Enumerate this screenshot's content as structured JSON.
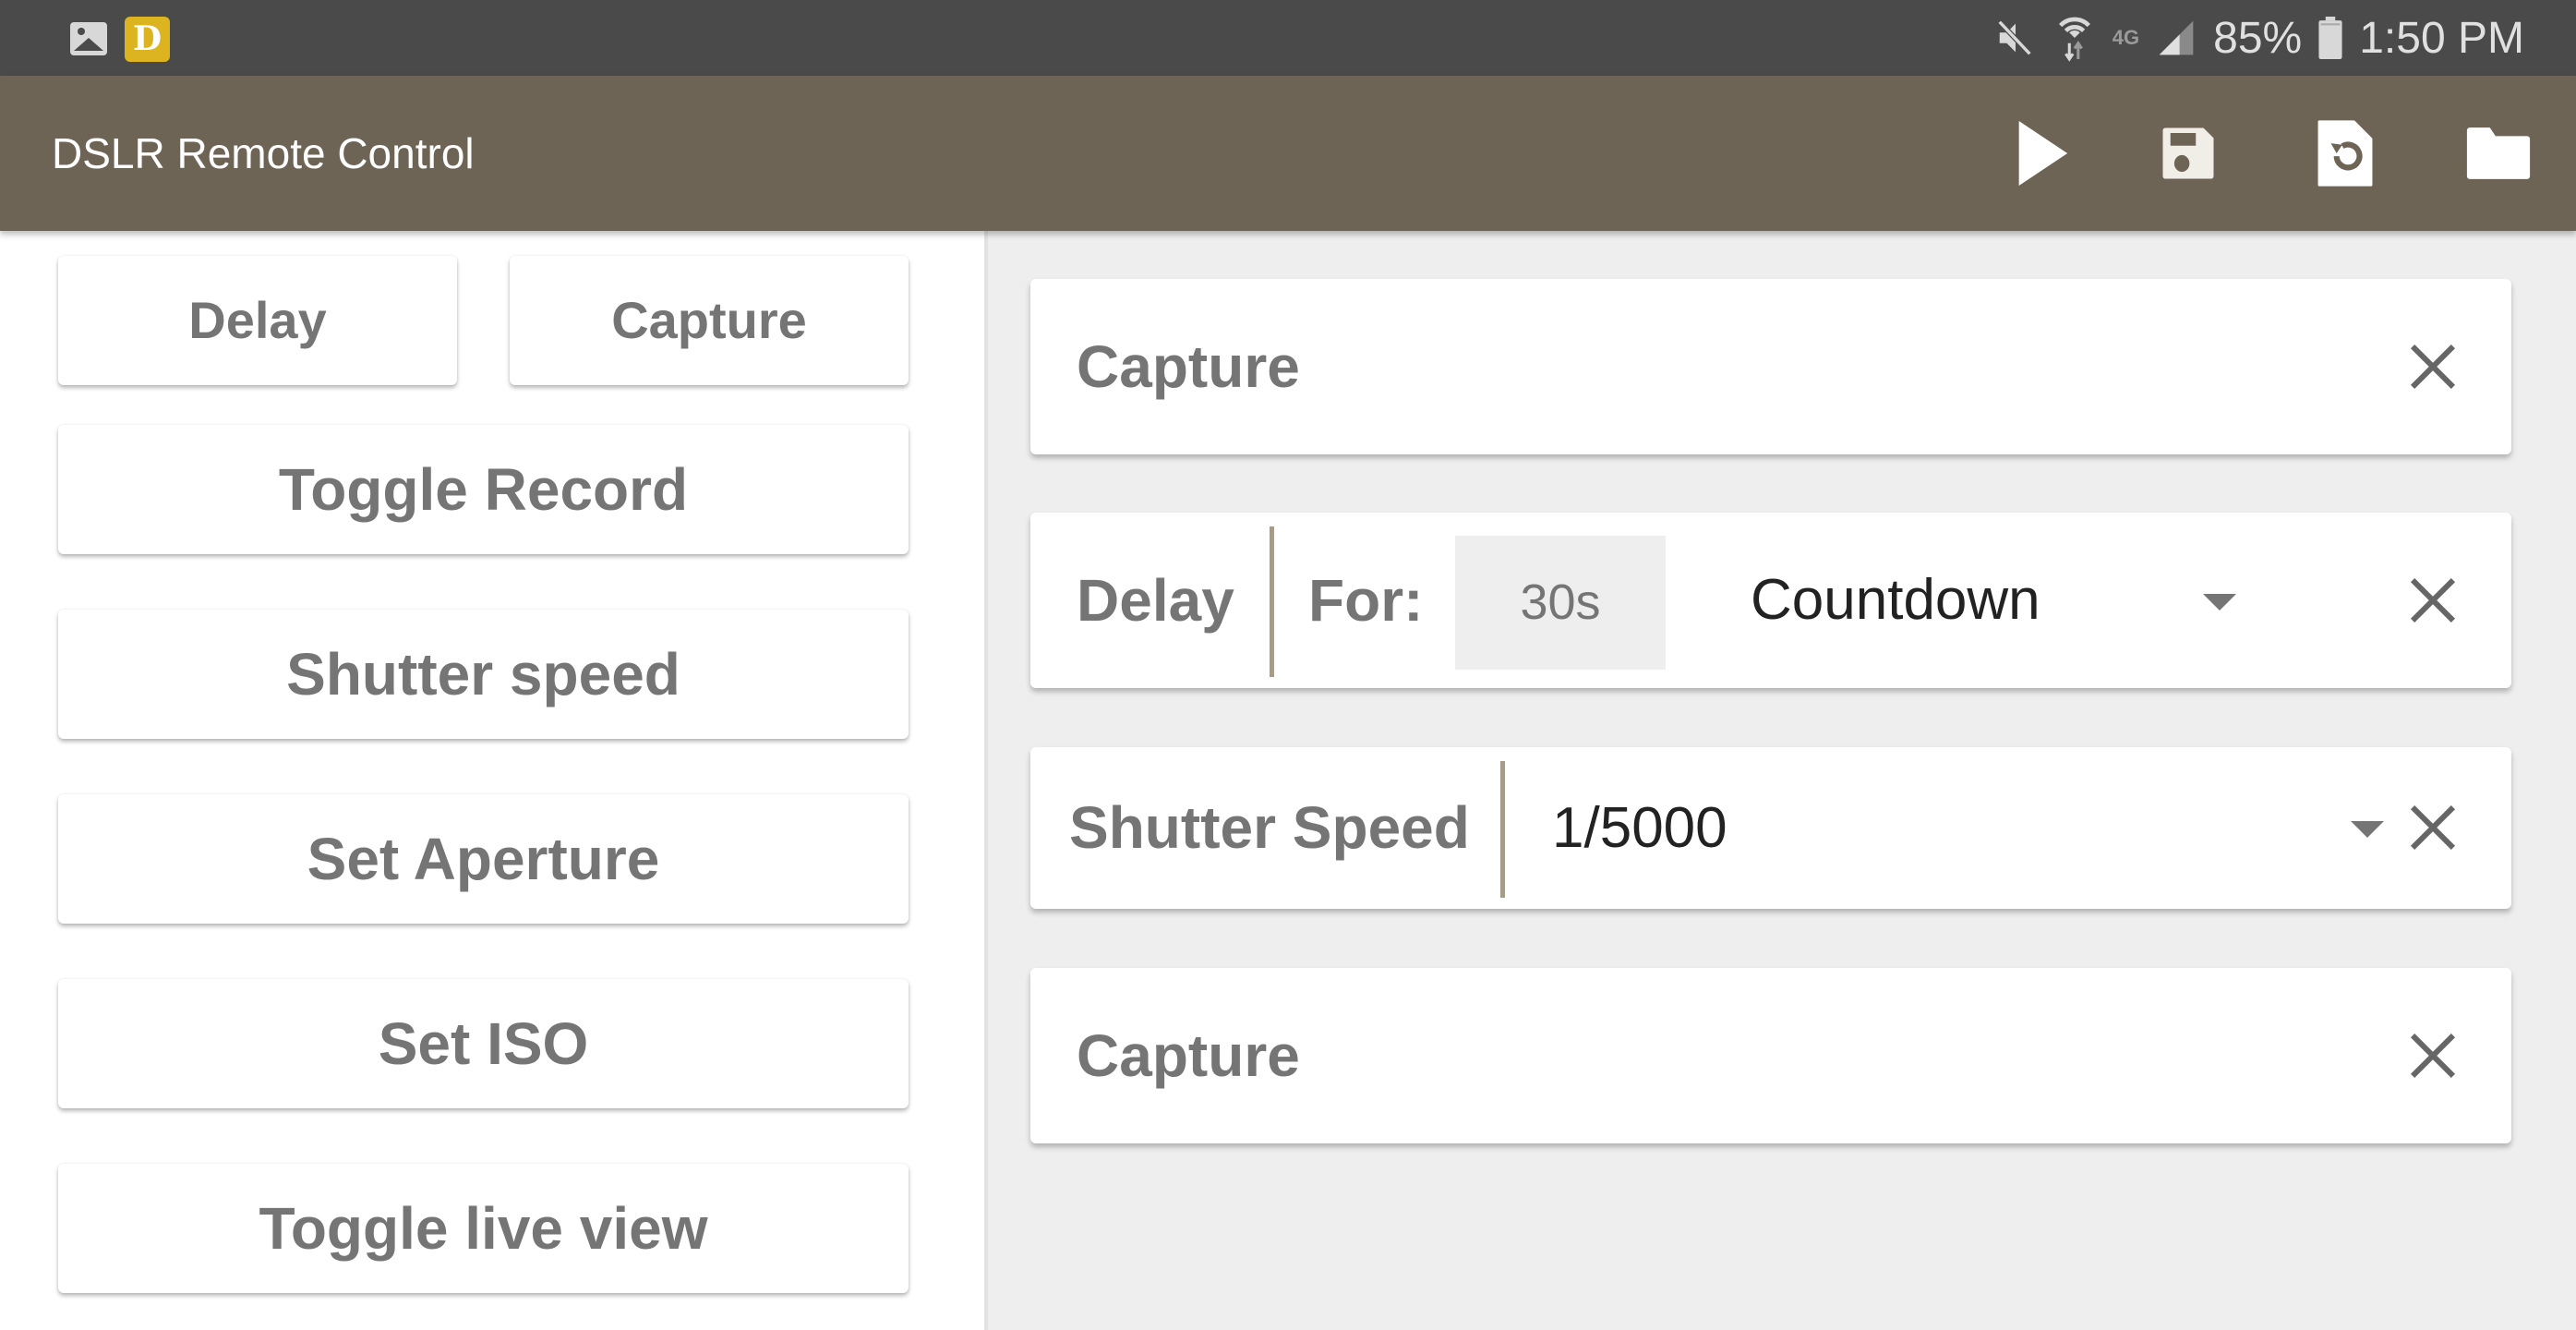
{
  "status_bar": {
    "left_icons": [
      "image-notification-icon",
      "dslr-app-notification-icon"
    ],
    "app_badge_letter": "D",
    "right_icons": [
      "mute-icon",
      "wifi-icon",
      "lte-icon",
      "signal-icon",
      "battery-icon"
    ],
    "network_label": "4G",
    "battery": "85%",
    "time": "1:50 PM"
  },
  "toolbar": {
    "title": "DSLR Remote Control",
    "actions": [
      "play",
      "save",
      "restore",
      "open-folder"
    ]
  },
  "commands": {
    "delay": "Delay",
    "capture": "Capture",
    "toggle_record": "Toggle Record",
    "shutter_speed": "Shutter speed",
    "set_aperture": "Set Aperture",
    "set_iso": "Set ISO",
    "toggle_live_view": "Toggle live view"
  },
  "sequence": [
    {
      "type": "capture",
      "label": "Capture"
    },
    {
      "type": "delay",
      "label": "Delay",
      "for_label": "For:",
      "value": "30s",
      "mode": "Countdown"
    },
    {
      "type": "shutter_speed",
      "label": "Shutter Speed",
      "value": "1/5000"
    },
    {
      "type": "capture",
      "label": "Capture"
    }
  ]
}
